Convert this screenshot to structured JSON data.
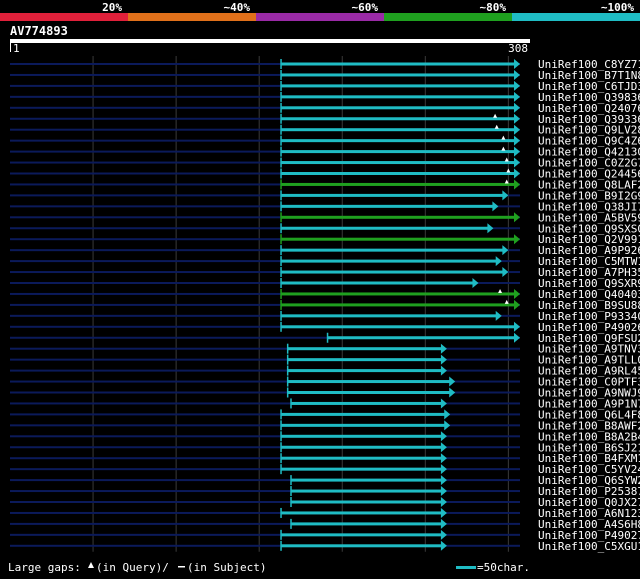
{
  "query": {
    "name": "AV774893",
    "start": "1",
    "end": "308",
    "length": 308
  },
  "identity_legend": [
    {
      "label": "20%",
      "color": "#e0203a"
    },
    {
      "label": "~40%",
      "color": "#e0701a"
    },
    {
      "label": "~60%",
      "color": "#9a2aa6"
    },
    {
      "label": "~80%",
      "color": "#1fa01f"
    },
    {
      "label": "~100%",
      "color": "#1fbcc4"
    }
  ],
  "footer": {
    "gaps_text": "Large gaps:",
    "gaps_query_text": "(in Query)/",
    "gaps_subject_text": "(in Subject)",
    "scale_text": "=50char."
  },
  "colors": {
    "background": "#000000",
    "track": "#0b1a5a",
    "grid": "#3a3a3a",
    "hit_high": "#1fbcc4",
    "hit_mid": "#1fa01f",
    "ruler": "#ffffff"
  },
  "chart_data": {
    "type": "alignment",
    "x_unit": "query position",
    "xlim": [
      1,
      308
    ],
    "hits": [
      {
        "name": "UniRef100_C8YZ71",
        "start": 164,
        "end": 308,
        "identity": "~100%",
        "subject_gaps": []
      },
      {
        "name": "UniRef100_B7T1N8",
        "start": 164,
        "end": 308,
        "identity": "~100%",
        "subject_gaps": []
      },
      {
        "name": "UniRef100_C6TJD3",
        "start": 164,
        "end": 308,
        "identity": "~100%",
        "subject_gaps": []
      },
      {
        "name": "UniRef100_Q39836",
        "start": 164,
        "end": 308,
        "identity": "~100%",
        "subject_gaps": []
      },
      {
        "name": "UniRef100_Q24076",
        "start": 164,
        "end": 308,
        "identity": "~100%",
        "subject_gaps": []
      },
      {
        "name": "UniRef100_Q39336",
        "start": 164,
        "end": 308,
        "identity": "~100%",
        "subject_gaps": [
          293
        ]
      },
      {
        "name": "UniRef100_Q9LV28",
        "start": 164,
        "end": 308,
        "identity": "~100%",
        "subject_gaps": [
          294
        ]
      },
      {
        "name": "UniRef100_Q9C4Z6",
        "start": 164,
        "end": 308,
        "identity": "~100%",
        "subject_gaps": [
          298
        ]
      },
      {
        "name": "UniRef100_Q42130",
        "start": 164,
        "end": 308,
        "identity": "~100%",
        "subject_gaps": [
          298
        ]
      },
      {
        "name": "UniRef100_C0Z2G7",
        "start": 164,
        "end": 308,
        "identity": "~100%",
        "subject_gaps": [
          300
        ]
      },
      {
        "name": "UniRef100_Q24456",
        "start": 164,
        "end": 308,
        "identity": "~100%",
        "subject_gaps": [
          301
        ]
      },
      {
        "name": "UniRef100_Q8LAF2",
        "start": 164,
        "end": 308,
        "identity": "~80%",
        "subject_gaps": [
          300
        ]
      },
      {
        "name": "UniRef100_B9I2G9",
        "start": 164,
        "end": 301,
        "identity": "~100%",
        "subject_gaps": []
      },
      {
        "name": "UniRef100_Q38JI7",
        "start": 164,
        "end": 295,
        "identity": "~100%",
        "subject_gaps": []
      },
      {
        "name": "UniRef100_A5BV59",
        "start": 164,
        "end": 308,
        "identity": "~80%",
        "subject_gaps": []
      },
      {
        "name": "UniRef100_Q9SXS0",
        "start": 164,
        "end": 292,
        "identity": "~100%",
        "subject_gaps": []
      },
      {
        "name": "UniRef100_Q2V991",
        "start": 164,
        "end": 308,
        "identity": "~80%",
        "subject_gaps": []
      },
      {
        "name": "UniRef100_A9P926",
        "start": 164,
        "end": 301,
        "identity": "~100%",
        "subject_gaps": []
      },
      {
        "name": "UniRef100_C5MTW1",
        "start": 164,
        "end": 297,
        "identity": "~100%",
        "subject_gaps": []
      },
      {
        "name": "UniRef100_A7PH35",
        "start": 164,
        "end": 301,
        "identity": "~100%",
        "subject_gaps": []
      },
      {
        "name": "UniRef100_Q9SXR9",
        "start": 164,
        "end": 283,
        "identity": "~100%",
        "subject_gaps": []
      },
      {
        "name": "UniRef100_Q40403",
        "start": 164,
        "end": 308,
        "identity": "~80%",
        "subject_gaps": [
          296
        ]
      },
      {
        "name": "UniRef100_B9SU88",
        "start": 164,
        "end": 308,
        "identity": "~80%",
        "subject_gaps": [
          300
        ]
      },
      {
        "name": "UniRef100_P93340",
        "start": 164,
        "end": 297,
        "identity": "~100%",
        "subject_gaps": []
      },
      {
        "name": "UniRef100_P49026",
        "start": 164,
        "end": 308,
        "identity": "~100%",
        "subject_gaps": []
      },
      {
        "name": "UniRef100_Q9FSU2",
        "start": 192,
        "end": 308,
        "identity": "~100%",
        "subject_gaps": []
      },
      {
        "name": "UniRef100_A9TNV3",
        "start": 168,
        "end": 264,
        "identity": "~100%",
        "subject_gaps": []
      },
      {
        "name": "UniRef100_A9TLL0",
        "start": 168,
        "end": 264,
        "identity": "~100%",
        "subject_gaps": []
      },
      {
        "name": "UniRef100_A9RL45",
        "start": 168,
        "end": 264,
        "identity": "~100%",
        "subject_gaps": []
      },
      {
        "name": "UniRef100_C0PTF3",
        "start": 168,
        "end": 269,
        "identity": "~100%",
        "subject_gaps": []
      },
      {
        "name": "UniRef100_A9NWJ9",
        "start": 168,
        "end": 269,
        "identity": "~100%",
        "subject_gaps": []
      },
      {
        "name": "UniRef100_A9P1N7",
        "start": 170,
        "end": 264,
        "identity": "~100%",
        "subject_gaps": []
      },
      {
        "name": "UniRef100_Q6L4F8",
        "start": 164,
        "end": 266,
        "identity": "~100%",
        "subject_gaps": []
      },
      {
        "name": "UniRef100_B8AWF2",
        "start": 164,
        "end": 266,
        "identity": "~100%",
        "subject_gaps": []
      },
      {
        "name": "UniRef100_B8A2B4",
        "start": 164,
        "end": 264,
        "identity": "~100%",
        "subject_gaps": []
      },
      {
        "name": "UniRef100_B6SJ21",
        "start": 164,
        "end": 264,
        "identity": "~100%",
        "subject_gaps": []
      },
      {
        "name": "UniRef100_B4FXM1",
        "start": 164,
        "end": 264,
        "identity": "~100%",
        "subject_gaps": []
      },
      {
        "name": "UniRef100_C5YV24",
        "start": 164,
        "end": 264,
        "identity": "~100%",
        "subject_gaps": []
      },
      {
        "name": "UniRef100_Q6SYW2",
        "start": 170,
        "end": 264,
        "identity": "~100%",
        "subject_gaps": []
      },
      {
        "name": "UniRef100_P25387",
        "start": 170,
        "end": 264,
        "identity": "~100%",
        "subject_gaps": []
      },
      {
        "name": "UniRef100_Q0JX27",
        "start": 170,
        "end": 264,
        "identity": "~100%",
        "subject_gaps": []
      },
      {
        "name": "UniRef100_A6N123",
        "start": 164,
        "end": 264,
        "identity": "~100%",
        "subject_gaps": []
      },
      {
        "name": "UniRef100_A4S6H8",
        "start": 170,
        "end": 264,
        "identity": "~100%",
        "subject_gaps": []
      },
      {
        "name": "UniRef100_P49027",
        "start": 164,
        "end": 264,
        "identity": "~100%",
        "subject_gaps": []
      },
      {
        "name": "UniRef100_C5XGU1",
        "start": 164,
        "end": 264,
        "identity": "~100%",
        "subject_gaps": []
      }
    ]
  }
}
